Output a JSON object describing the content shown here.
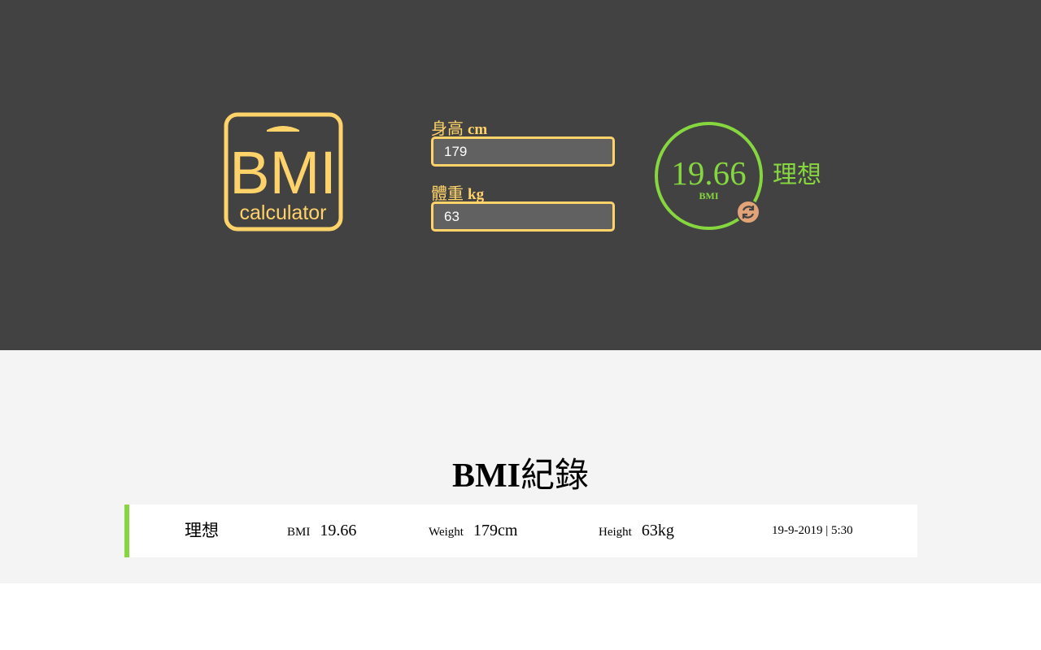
{
  "logo": {
    "main": "BMI",
    "sub": "calculator",
    "color": "#ffd369"
  },
  "form": {
    "height": {
      "label": "身高",
      "unit": "cm",
      "value": "179"
    },
    "weight": {
      "label": "體重",
      "unit": "kg",
      "value": "63"
    }
  },
  "result": {
    "value": "19.66",
    "unit": "BMI",
    "status": "理想",
    "color": "#86d73f",
    "reset_icon": "refresh-icon"
  },
  "records": {
    "title_latin": "BMI",
    "title_han": "紀錄",
    "items": [
      {
        "status": "理想",
        "bmi_label": "BMI",
        "bmi_value": "19.66",
        "weight_label": "Weight",
        "weight_value": "179cm",
        "height_label": "Height",
        "height_value": "63kg",
        "date": "19-9-2019 | 5:30",
        "status_color": "#86d73f"
      }
    ]
  }
}
